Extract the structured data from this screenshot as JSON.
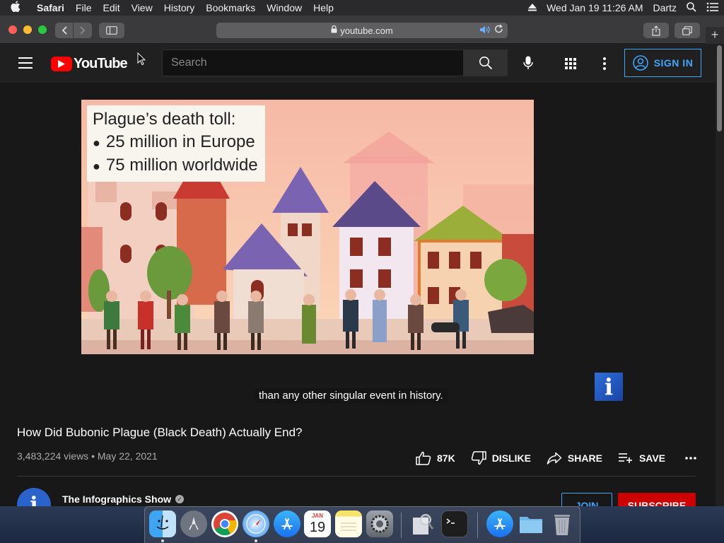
{
  "menubar": {
    "app_name": "Safari",
    "menus": [
      "File",
      "Edit",
      "View",
      "History",
      "Bookmarks",
      "Window",
      "Help"
    ],
    "datetime": "Wed Jan 19  11:26 AM",
    "user": "Dartz"
  },
  "browser": {
    "url": "youtube.com"
  },
  "youtube": {
    "logo_text": "YouTube",
    "search_placeholder": "Search",
    "sign_in_label": "SIGN IN",
    "video": {
      "overlay_heading": "Plague’s death toll:",
      "overlay_items": [
        "25 million in Europe",
        "75 million worldwide"
      ],
      "caption": "than any other singular event in history.",
      "badge": "i"
    },
    "title": "How Did Bubonic Plague (Black Death) Actually End?",
    "views": "3,483,224 views",
    "date": "May 22, 2021",
    "like_count": "87K",
    "dislike_label": "DISLIKE",
    "share_label": "SHARE",
    "save_label": "SAVE",
    "channel_name": "The Infographics Show",
    "channel_avatar_letter": "i",
    "join_label": "JOIN",
    "subscribe_label": "SUBSCRIBE"
  },
  "dock": {
    "calendar_month": "JAN",
    "calendar_day": "19",
    "apps": [
      "Finder",
      "Launchpad",
      "Google Chrome",
      "Safari",
      "App Store",
      "Calendar",
      "Notes",
      "System Preferences",
      "Preview",
      "Terminal",
      "App Store",
      "Folder",
      "Trash"
    ]
  },
  "colors": {
    "yt_red": "#ff0000",
    "yt_blue": "#3ea6ff",
    "subscribe_red": "#cc0000",
    "yt_background": "#181818"
  }
}
